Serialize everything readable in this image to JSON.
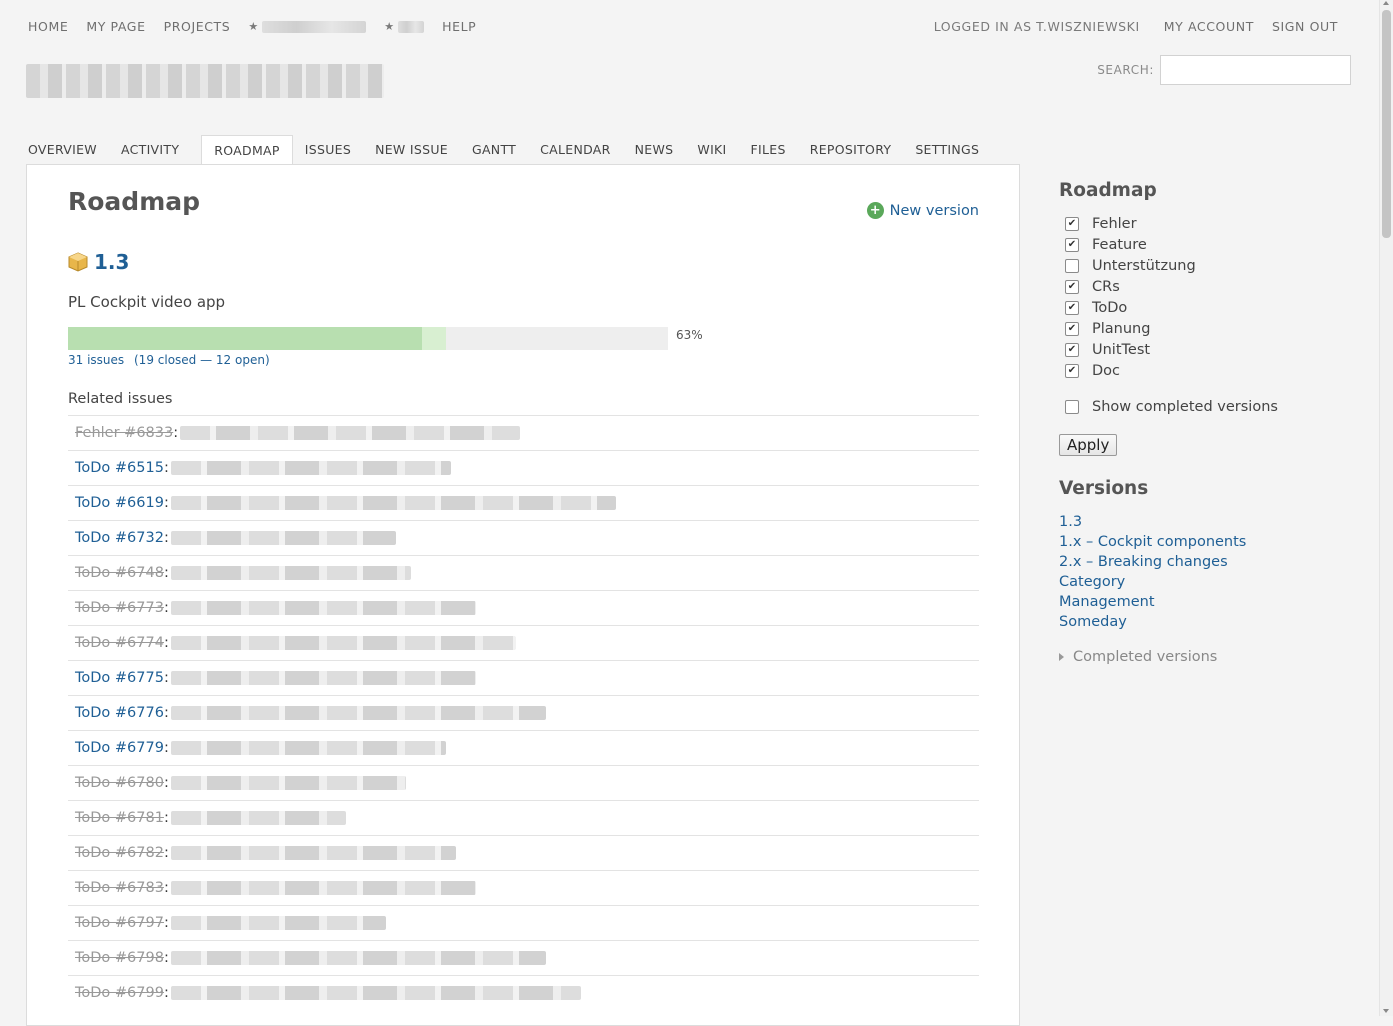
{
  "top_menu": {
    "items": [
      "HOME",
      "MY PAGE",
      "PROJECTS"
    ],
    "star_glyph": "★",
    "help": "HELP",
    "logged_in_as": "LOGGED IN AS T.WISZNIEWSKI",
    "my_account": "MY ACCOUNT",
    "sign_out": "SIGN OUT"
  },
  "search": {
    "label": "SEARCH:",
    "value": ""
  },
  "main_menu": {
    "tabs": [
      "OVERVIEW",
      "ACTIVITY",
      "ROADMAP",
      "ISSUES",
      "NEW ISSUE",
      "GANTT",
      "CALENDAR",
      "NEWS",
      "WIKI",
      "FILES",
      "REPOSITORY",
      "SETTINGS"
    ],
    "selected": "ROADMAP"
  },
  "content": {
    "title": "Roadmap",
    "new_version": "New version",
    "version": {
      "name": "1.3",
      "description": "PL Cockpit video app",
      "progress_closed_percent": 59,
      "progress_done_percent": 63,
      "progress_label": "63%",
      "issues_link": "31 issues",
      "status_link": "(19 closed — 12 open)"
    },
    "related_issues_title": "Related issues",
    "issues": [
      {
        "label": "Fehler #6833",
        "closed": true
      },
      {
        "label": "ToDo #6515",
        "closed": false
      },
      {
        "label": "ToDo #6619",
        "closed": false
      },
      {
        "label": "ToDo #6732",
        "closed": false
      },
      {
        "label": "ToDo #6748",
        "closed": true
      },
      {
        "label": "ToDo #6773",
        "closed": true
      },
      {
        "label": "ToDo #6774",
        "closed": true
      },
      {
        "label": "ToDo #6775",
        "closed": false
      },
      {
        "label": "ToDo #6776",
        "closed": false
      },
      {
        "label": "ToDo #6779",
        "closed": false
      },
      {
        "label": "ToDo #6780",
        "closed": true
      },
      {
        "label": "ToDo #6781",
        "closed": true
      },
      {
        "label": "ToDo #6782",
        "closed": true
      },
      {
        "label": "ToDo #6783",
        "closed": true
      },
      {
        "label": "ToDo #6797",
        "closed": true
      },
      {
        "label": "ToDo #6798",
        "closed": true
      },
      {
        "label": "ToDo #6799",
        "closed": true
      }
    ]
  },
  "sidebar": {
    "roadmap_title": "Roadmap",
    "trackers": [
      {
        "label": "Fehler",
        "checked": true
      },
      {
        "label": "Feature",
        "checked": true
      },
      {
        "label": "Unterstützung",
        "checked": false
      },
      {
        "label": "CRs",
        "checked": true
      },
      {
        "label": "ToDo",
        "checked": true
      },
      {
        "label": "Planung",
        "checked": true
      },
      {
        "label": "UnitTest",
        "checked": true
      },
      {
        "label": "Doc",
        "checked": true
      }
    ],
    "show_completed": {
      "label": "Show completed versions",
      "checked": false
    },
    "apply": "Apply",
    "versions_title": "Versions",
    "versions": [
      "1.3",
      "1.x – Cockpit components",
      "2.x – Breaking changes",
      "Category",
      "Management",
      "Someday"
    ],
    "completed_versions": "Completed versions"
  },
  "colors": {
    "link": "#1f5f95",
    "progress_closed": "#b8dfb0",
    "progress_done": "#d8efd1",
    "progress_bg": "#eeeeee"
  }
}
